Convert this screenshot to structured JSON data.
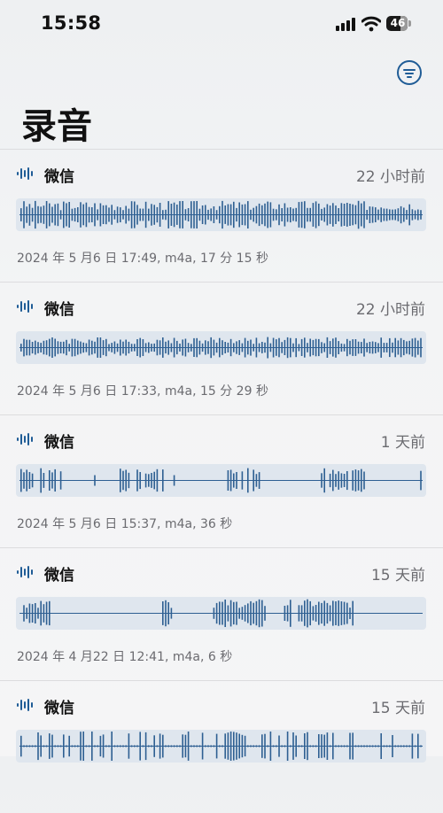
{
  "status": {
    "time": "15:58",
    "battery": "46"
  },
  "page": {
    "title": "录音"
  },
  "colors": {
    "accent": "#1f5c96",
    "wave_bar": "#2e5f92",
    "wave_bg": "#dfe6ee"
  },
  "icons": {
    "filter": "filter-circle-icon",
    "waveform": "waveform-icon"
  },
  "recordings": [
    {
      "title": "微信",
      "ago": "22 小时前",
      "meta": "2024 年 5 月6 日 17:49, m4a, 17 分 15 秒",
      "pattern": "dense"
    },
    {
      "title": "微信",
      "ago": "22 小时前",
      "meta": "2024 年 5 月6 日 17:33, m4a, 15 分 29 秒",
      "pattern": "medium"
    },
    {
      "title": "微信",
      "ago": "1 天前",
      "meta": "2024 年 5 月6 日 15:37, m4a, 36 秒",
      "pattern": "sparse"
    },
    {
      "title": "微信",
      "ago": "15 天前",
      "meta": "2024 年 4 月22 日 12:41, m4a, 6 秒",
      "pattern": "bursts"
    },
    {
      "title": "微信",
      "ago": "15 天前",
      "meta": "",
      "pattern": "spiky"
    }
  ]
}
